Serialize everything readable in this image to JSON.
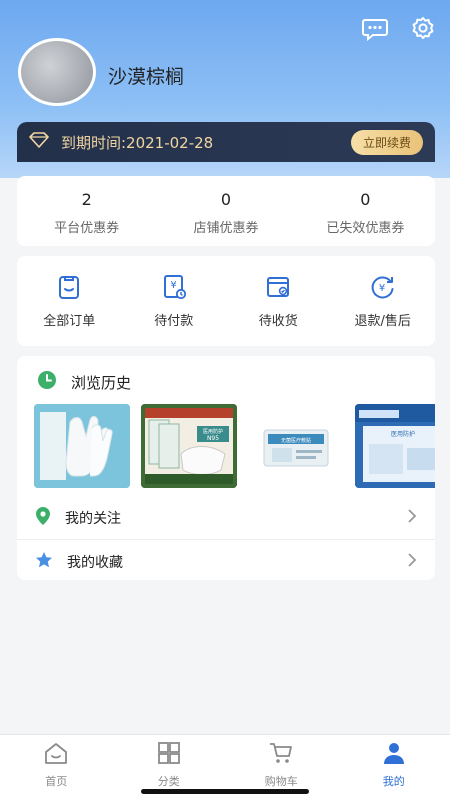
{
  "header": {
    "username": "沙漠棕榈",
    "icons": [
      "chat-icon",
      "settings-icon"
    ]
  },
  "vip": {
    "expiry_text": "到期时间:2021-02-28",
    "renew_label": "立即续费"
  },
  "coupons": [
    {
      "count": "2",
      "label": "平台优惠券"
    },
    {
      "count": "0",
      "label": "店铺优惠券"
    },
    {
      "count": "0",
      "label": "已失效优惠券"
    }
  ],
  "orders": [
    {
      "label": "全部订单",
      "icon": "clipboard-icon"
    },
    {
      "label": "待付款",
      "icon": "payment-icon"
    },
    {
      "label": "待收货",
      "icon": "delivery-icon"
    },
    {
      "label": "退款/售后",
      "icon": "refund-icon"
    }
  ],
  "history": {
    "title": "浏览历史",
    "thumbnail_texts": [
      "医用防护",
      "N95",
      "无菌医疗敷贴"
    ]
  },
  "menu": {
    "follow_label": "我的关注",
    "favorites_label": "我的收藏"
  },
  "tabbar": [
    {
      "label": "首页",
      "icon": "home-icon"
    },
    {
      "label": "分类",
      "icon": "grid-icon"
    },
    {
      "label": "购物车",
      "icon": "cart-icon"
    },
    {
      "label": "我的",
      "icon": "user-icon"
    }
  ],
  "colors": {
    "accent": "#2f6fd6",
    "header_blue": "#6da8ef",
    "vip_dark": "#23304a",
    "vip_gold": "#f1d6a2",
    "green": "#3cb06a"
  }
}
